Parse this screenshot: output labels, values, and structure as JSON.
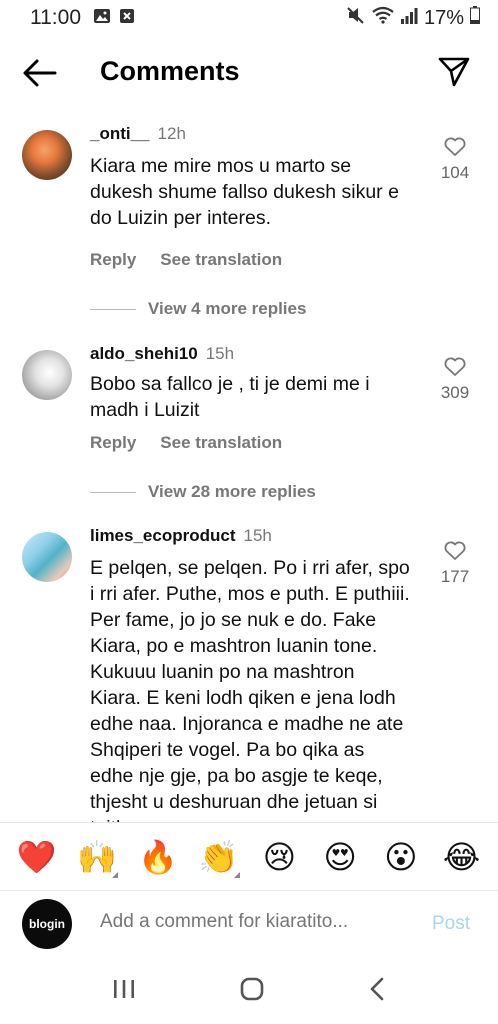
{
  "status": {
    "time": "11:00",
    "battery": "17%"
  },
  "header": {
    "title": "Comments"
  },
  "comments": [
    {
      "username": "_onti__",
      "time": "12h",
      "text": "Kiara me mire mos u marto se dukesh shume fallso dukesh sikur e do Luizin per interes.",
      "likes": "104",
      "reply": "Reply",
      "translate": "See translation",
      "more": "View 4 more replies"
    },
    {
      "username": "aldo_shehi10",
      "time": "15h",
      "text": "Bobo sa fallco je , ti je demi me i madh i Luizit",
      "likes": "309",
      "reply": "Reply",
      "translate": "See translation",
      "more": "View 28 more replies"
    },
    {
      "username": "limes_ecoproduct",
      "time": "15h",
      "text": "E pelqen, se pelqen. Po i rri afer, spo i rri afer. Puthe, mos e puth. E puthiii. Per fame, jo jo se nuk e do. Fake Kiara, po  e mashtron luanin tone. Kukuuu luanin po na mashtron Kiara. E keni lodh qiken e jena lodh edhe naa. Injoranca e madhe ne ate Shqiperi te vogel. Pa bo qika as edhe nje gje, pa bo asgje te keqe, thjesht u deshuruan dhe jetuan si tajtha",
      "likes": "177"
    }
  ],
  "emojis": [
    "❤️",
    "🙌",
    "🔥",
    "👏",
    "😢",
    "😍",
    "😮",
    "😂"
  ],
  "composer": {
    "avatar_text": "blogin",
    "placeholder": "Add a comment for kiaratito...",
    "post": "Post"
  },
  "colors": {
    "accent_disabled": "#a8d4f5",
    "muted_text": "#777777"
  }
}
